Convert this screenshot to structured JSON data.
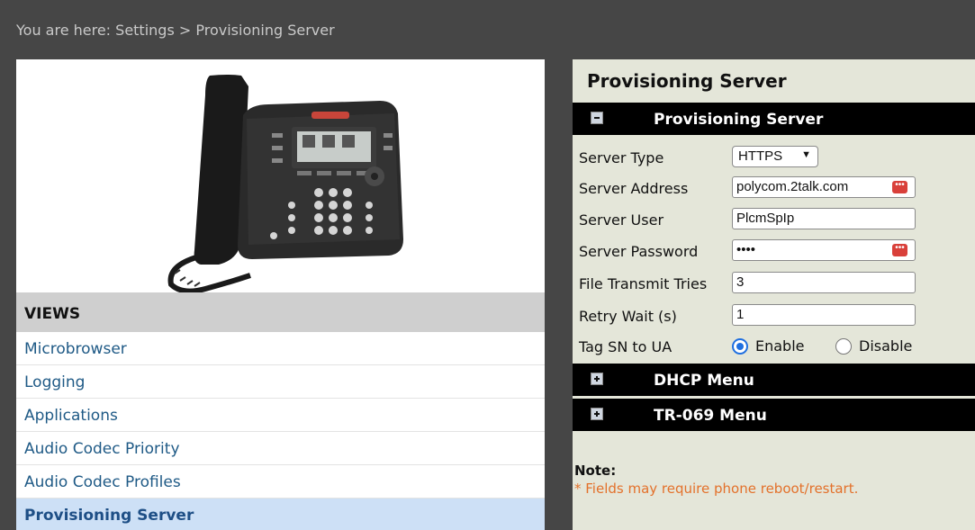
{
  "breadcrumb": "You are here: Settings > Provisioning Server",
  "views": {
    "header": "VIEWS",
    "items": [
      {
        "label": "Microbrowser",
        "active": false
      },
      {
        "label": "Logging",
        "active": false
      },
      {
        "label": "Applications",
        "active": false
      },
      {
        "label": "Audio Codec Priority",
        "active": false
      },
      {
        "label": "Audio Codec Profiles",
        "active": false
      },
      {
        "label": "Provisioning Server",
        "active": true
      }
    ]
  },
  "phone": {
    "brand_logo": "Polycom"
  },
  "panel": {
    "title": "Provisioning Server",
    "section_main": "Provisioning Server",
    "fields": {
      "server_type_label": "Server Type",
      "server_type_value": "HTTPS",
      "server_address_label": "Server Address",
      "server_address_value": "polycom.2talk.com",
      "server_user_label": "Server User",
      "server_user_value": "PlcmSpIp",
      "server_password_label": "Server Password",
      "server_password_value": "••••",
      "file_transmit_label": "File Transmit Tries",
      "file_transmit_value": "3",
      "retry_wait_label": "Retry Wait (s)",
      "retry_wait_value": "1",
      "tag_sn_label": "Tag SN to UA",
      "enable_label": "Enable",
      "disable_label": "Disable"
    },
    "section_dhcp": "DHCP Menu",
    "section_tr069": "TR-069 Menu",
    "note_title": "Note:",
    "note_text": "* Fields may require phone reboot/restart."
  },
  "colors": {
    "accent": "#1f6fe0",
    "note": "#e3712b",
    "active_nav": "#cde0f6"
  }
}
